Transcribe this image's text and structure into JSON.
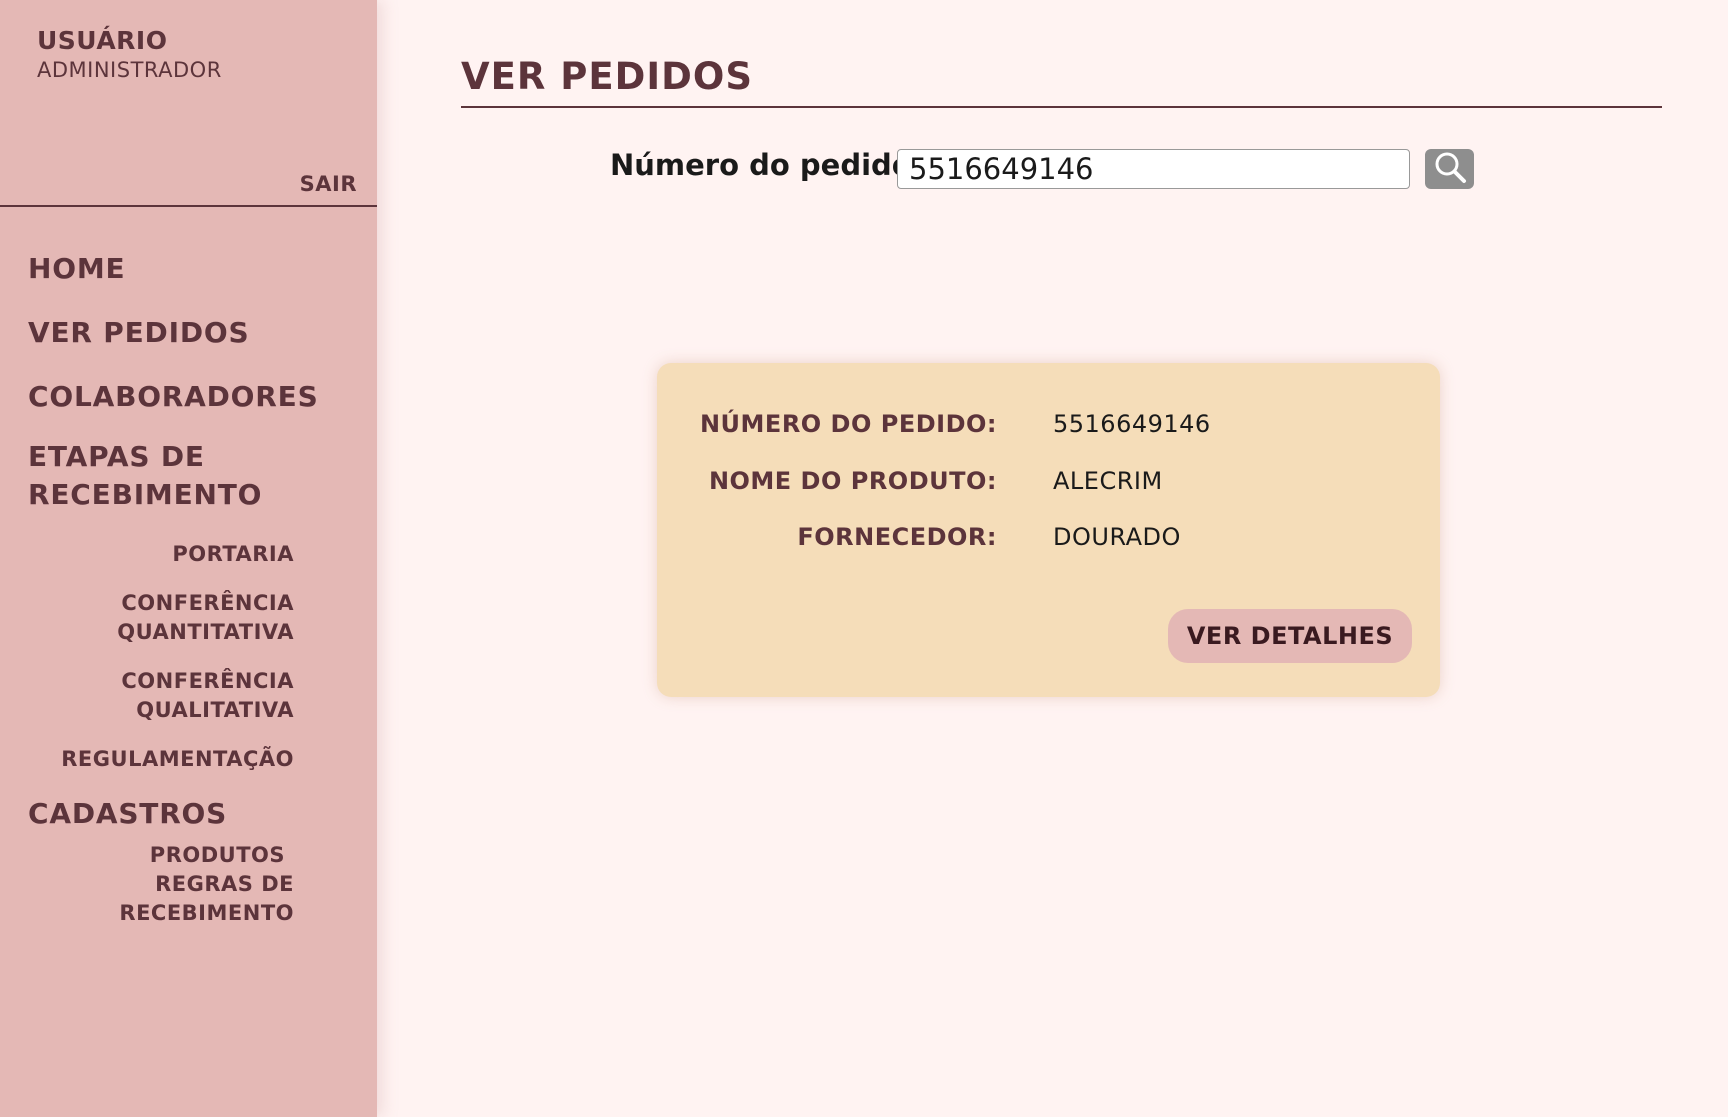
{
  "sidebar": {
    "user_name": "USUÁRIO",
    "user_role": "ADMINISTRADOR",
    "logout_label": "SAIR",
    "nav": {
      "home": "HOME",
      "orders": "VER PEDIDOS",
      "collaborators": "COLABORADORES",
      "stages_line1": "ETAPAS DE",
      "stages_line2": "RECEBIMENTO",
      "gatehouse": "PORTARIA",
      "quant_line1": "CONFERÊNCIA",
      "quant_line2": "QUANTITATIVA",
      "qual_line1": "CONFERÊNCIA",
      "qual_line2": "QUALITATIVA",
      "regulation": "REGULAMENTAÇÃO",
      "registrations": "CADASTROS",
      "products": "PRODUTOS",
      "rules_line1": "REGRAS DE",
      "rules_line2": "RECEBIMENTO"
    }
  },
  "main": {
    "title": "VER PEDIDOS",
    "search": {
      "label": "Número do pedido:",
      "value": "5516649146",
      "button_icon": "search-icon"
    },
    "result": {
      "order_number_label": "NÚMERO DO PEDIDO:",
      "order_number_value": "5516649146",
      "product_name_label": "NOME DO PRODUTO:",
      "product_name_value": "ALECRIM",
      "supplier_label": "FORNECEDOR:",
      "supplier_value": "DOURADO",
      "details_button": "VER DETALHES"
    }
  },
  "colors": {
    "sidebar_bg": "#e4b8b5",
    "page_bg": "#fff3f2",
    "card_bg": "#f5ddb9",
    "text_primary": "#5c343b"
  }
}
